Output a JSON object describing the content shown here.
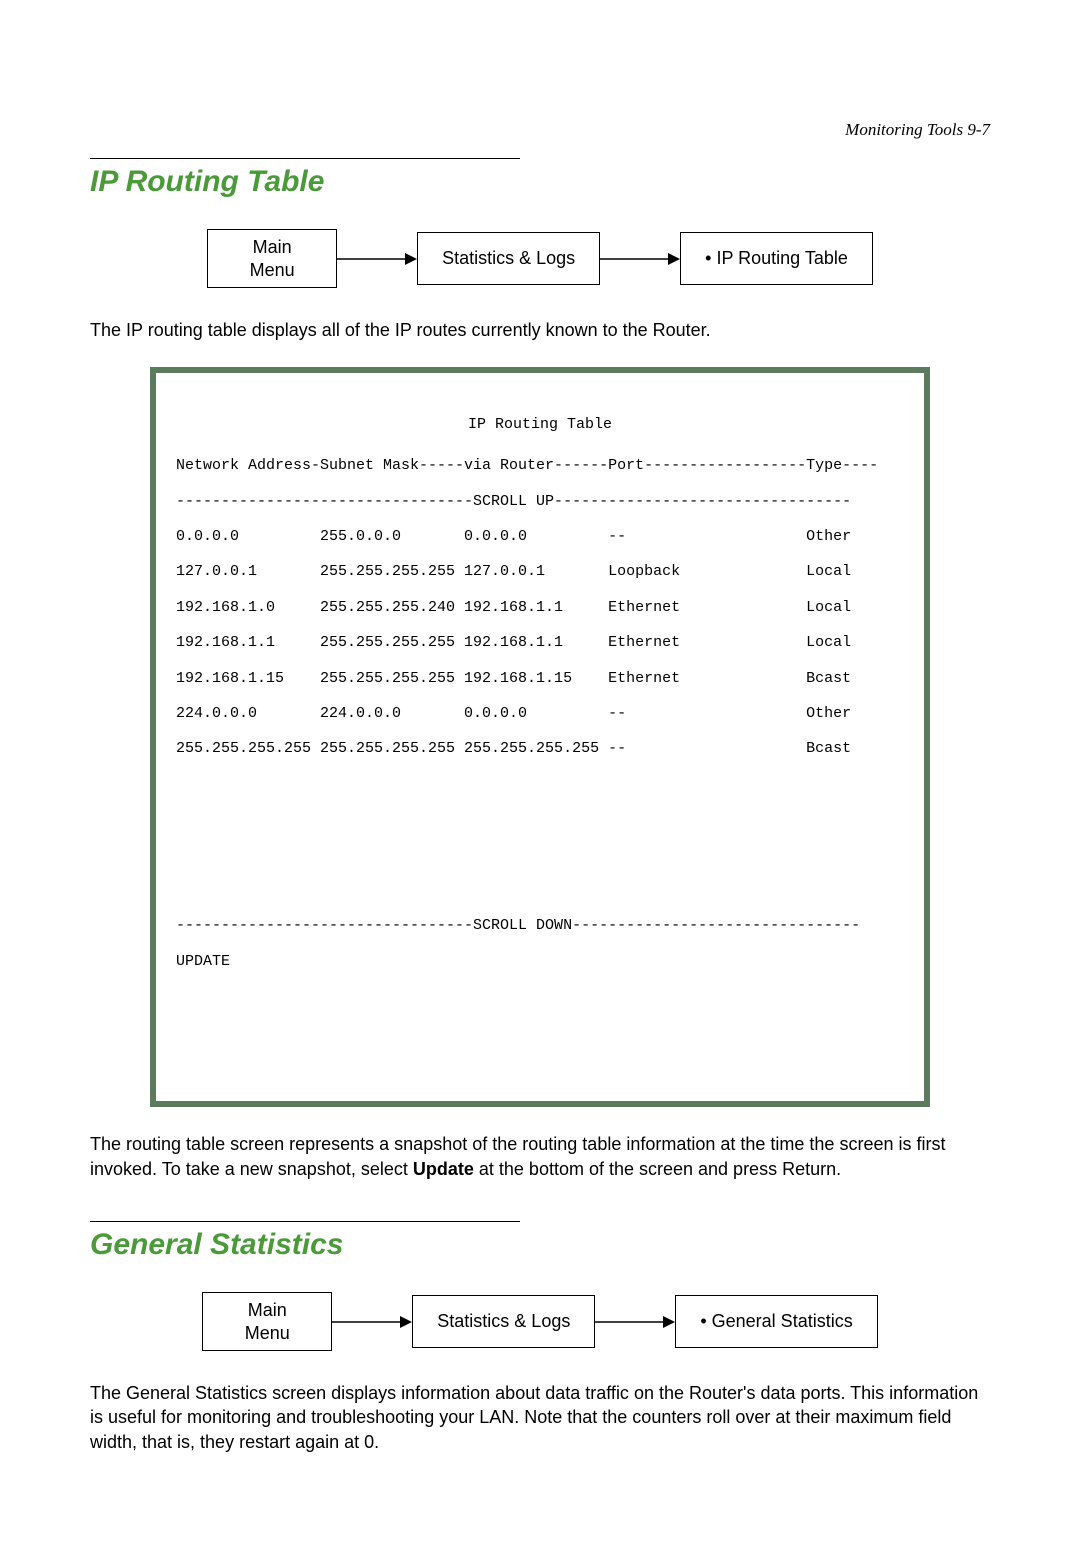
{
  "page_header": "Monitoring Tools   9-7",
  "section1": {
    "title": "IP Routing Table",
    "crumb1_line1": "Main",
    "crumb1_line2": "Menu",
    "crumb2": "Statistics & Logs",
    "crumb3": "•  IP Routing Table",
    "intro": "The IP routing table displays all of the IP routes currently known to the Router.",
    "terminal_title": "IP Routing Table",
    "terminal_header": "Network Address-Subnet Mask-----via Router------Port------------------Type----",
    "terminal_scroll_up": "---------------------------------SCROLL UP---------------------------------",
    "terminal_rows": [
      "0.0.0.0         255.0.0.0       0.0.0.0         --                    Other",
      "127.0.0.1       255.255.255.255 127.0.0.1       Loopback              Local",
      "192.168.1.0     255.255.255.240 192.168.1.1     Ethernet              Local",
      "192.168.1.1     255.255.255.255 192.168.1.1     Ethernet              Local",
      "192.168.1.15    255.255.255.255 192.168.1.15    Ethernet              Bcast",
      "224.0.0.0       224.0.0.0       0.0.0.0         --                    Other",
      "255.255.255.255 255.255.255.255 255.255.255.255 --                    Bcast"
    ],
    "terminal_scroll_down": "---------------------------------SCROLL DOWN--------------------------------",
    "terminal_update": "UPDATE",
    "outro_pre": "The routing table screen represents a snapshot of the routing table information at the time the screen is first invoked. To take a new snapshot, select ",
    "outro_bold": "Update",
    "outro_post": " at the bottom of the screen and press Return."
  },
  "section2": {
    "title": "General Statistics",
    "crumb1_line1": "Main",
    "crumb1_line2": "Menu",
    "crumb2": "Statistics & Logs",
    "crumb3": "•  General Statistics",
    "intro": "The General Statistics screen displays information about data traffic on the Router's data ports. This information is useful for monitoring and troubleshooting your LAN. Note that the counters roll over at their maximum field width, that is, they restart again at 0."
  }
}
